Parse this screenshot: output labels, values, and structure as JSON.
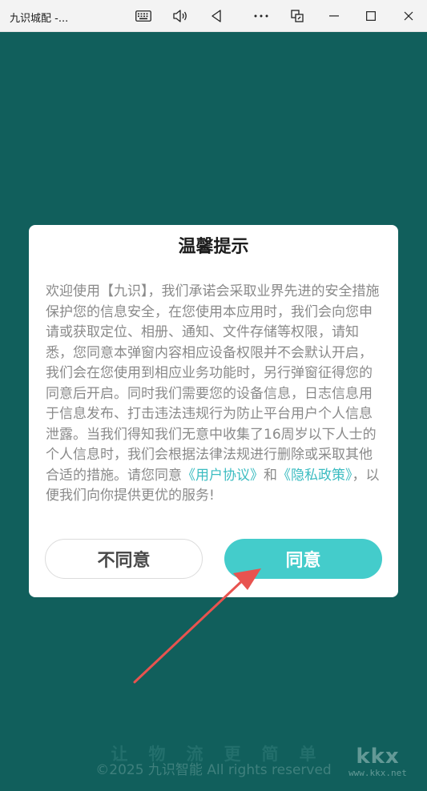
{
  "window": {
    "title": "九识城配 -...",
    "icons": [
      "keyboard-icon",
      "volume-icon",
      "back-icon",
      "more-icon",
      "screen-rotate-icon",
      "minimize-icon",
      "maximize-icon",
      "close-icon"
    ]
  },
  "dialog": {
    "title": "温馨提示",
    "body_text": "欢迎使用【九识】，我们承诺会采取业界先进的安全措施保护您的信息安全，在您使用本应用时，我们会向您申请或获取定位、相册、通知、文件存储等权限，请知悉，您同意本弹窗内容相应设备权限并不会默认开启，我们会在您使用到相应业务功能时，另行弹窗征得您的同意后开启。同时我们需要您的设备信息，日志信息用于信息发布、打击违法违规行为防止平台用户个人信息泄露。当我们得知我们无意中收集了16周岁以下人士的个人信息时，我们会根据法律法规进行删除或采取其他合适的措施。请您同意",
    "link_user_agreement": "《用户协议》",
    "conjunction": "和",
    "link_privacy_policy": "《隐私政策》",
    "body_tail": "，以便我们向你提供更优的服务!",
    "disagree_label": "不同意",
    "agree_label": "同意"
  },
  "footer": {
    "slogan": "让物流更简单",
    "copyright": "©2025 九识智能 All rights reserved"
  },
  "watermark": {
    "logo": "kkx",
    "url": "www.kkx.net"
  },
  "colors": {
    "background": "#115f5c",
    "agree_button": "#44cccb",
    "link": "#3bbcc1",
    "annotation_arrow": "#e8534f"
  }
}
